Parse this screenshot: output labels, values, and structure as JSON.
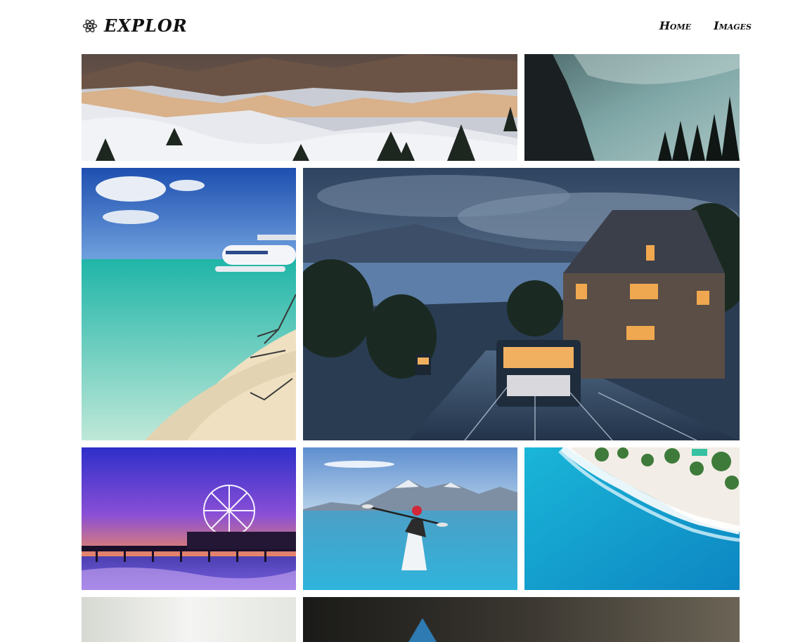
{
  "brand": {
    "name": "EXPLOR",
    "icon": "atom-icon"
  },
  "nav": {
    "items": [
      {
        "label": "Home"
      },
      {
        "label": "Images"
      }
    ]
  },
  "gallery": {
    "tiles": [
      {
        "id": "snowy-mountains-night"
      },
      {
        "id": "cliff-valley"
      },
      {
        "id": "tropical-beach-seaplane"
      },
      {
        "id": "town-tram-rainy-evening"
      },
      {
        "id": "pier-ferris-wheel-sunset"
      },
      {
        "id": "kayak-lake-mountains"
      },
      {
        "id": "aerial-ocean-beach"
      },
      {
        "id": "bright-white-image"
      },
      {
        "id": "dark-image"
      }
    ]
  }
}
